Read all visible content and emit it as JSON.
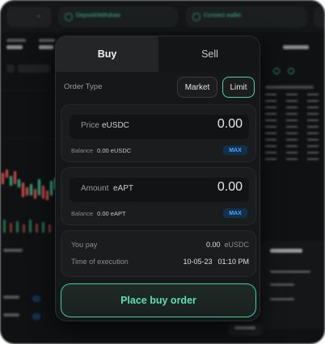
{
  "background": {
    "header": {
      "pill_1_text": "Deposit/Withdraw",
      "pill_2_text": "Connect wallet"
    }
  },
  "tabs": {
    "buy_label": "Buy",
    "sell_label": "Sell",
    "active": "Buy"
  },
  "order_type": {
    "label": "Order Type",
    "options": [
      "Market",
      "Limit"
    ],
    "selected": "Limit"
  },
  "price_field": {
    "label": "Price",
    "unit": "eUSDC",
    "value": "0.00",
    "balance_label": "Balance",
    "balance_value": "0.00 eUSDC",
    "max_label": "MAX"
  },
  "amount_field": {
    "label": "Amount",
    "unit": "eAPT",
    "value": "0.00",
    "balance_label": "Balance",
    "balance_value": "0.00 eAPT",
    "max_label": "MAX"
  },
  "summary": {
    "you_pay_label": "You pay",
    "you_pay_value": "0.00",
    "you_pay_unit": "eUSDC",
    "execution_label": "Time of execution",
    "execution_date": "10-05-23",
    "execution_time": "01:10 PM"
  },
  "submit": {
    "label": "Place buy order"
  },
  "colors": {
    "accent": "#4fd1a8",
    "button_text": "#5ce0b2",
    "max_badge": "#4da6ff",
    "panel": "#161718",
    "active_tab": "#232526"
  }
}
